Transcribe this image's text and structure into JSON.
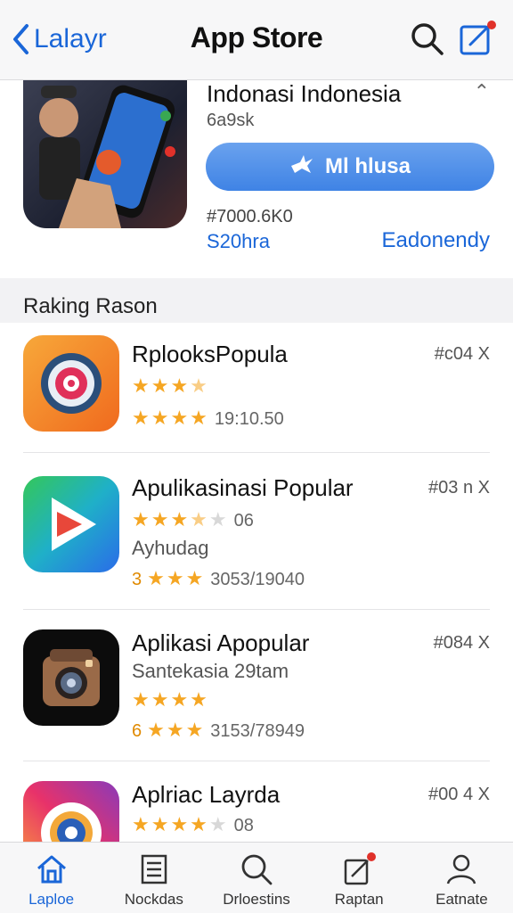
{
  "header": {
    "back_label": "Lalayr",
    "title": "App Store",
    "icons": [
      "chevron-left-icon",
      "search-icon",
      "compose-icon"
    ]
  },
  "featured": {
    "title": "Indonasi Indonesia",
    "subtitle": "6a9sk",
    "button_label": "Ml hlusa",
    "price": "#7000.6K0",
    "size": "S20hra",
    "link": "Eadonendy"
  },
  "section_label": "Raking Rason",
  "apps": [
    {
      "name": "RplooksPopula",
      "rank": "#c04 X",
      "rating_stars": 4,
      "meta": "19:10.50"
    },
    {
      "name": "Apulikasinasi Popular",
      "rank": "#03 n X",
      "rating_stars": 3.5,
      "rating_meta": "06",
      "subtitle": "Ayhudag",
      "lead": "3",
      "meta": "3053/19040"
    },
    {
      "name": "Aplikasi Apopular",
      "rank": "#084 X",
      "subtitle": "Santekasia 29tam",
      "rating_stars": 4,
      "lead": "6",
      "meta": "3153/78949"
    },
    {
      "name": "Aplriac Layrda",
      "rank": "#00 4 X",
      "rating_stars": 4,
      "rating_meta": "08"
    }
  ],
  "tabs": [
    {
      "label": "Laploe",
      "icon": "home-icon",
      "active": true
    },
    {
      "label": "Nockdas",
      "icon": "list-icon",
      "active": false
    },
    {
      "label": "Drloestins",
      "icon": "search-icon",
      "active": false
    },
    {
      "label": "Raptan",
      "icon": "updates-icon",
      "active": false
    },
    {
      "label": "Eatnate",
      "icon": "person-icon",
      "active": false
    }
  ],
  "colors": {
    "accent": "#1a66d8",
    "star": "#f5a623",
    "badge": "#e0312a"
  }
}
